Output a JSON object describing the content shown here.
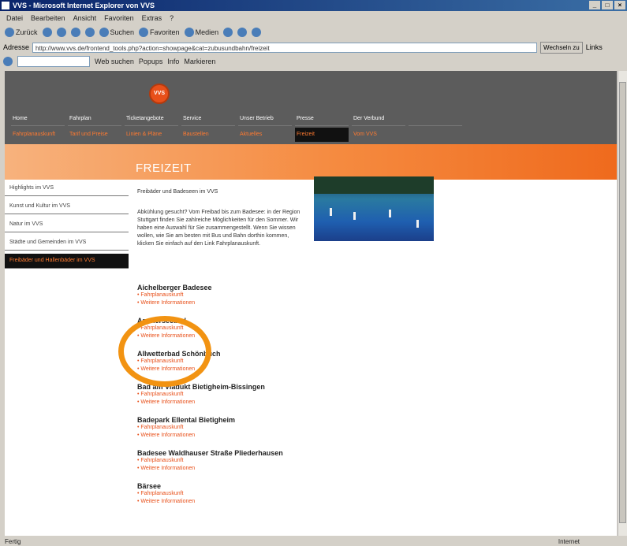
{
  "window": {
    "title": "VVS - Microsoft Internet Explorer von VVS"
  },
  "menubar": [
    "Datei",
    "Bearbeiten",
    "Ansicht",
    "Favoriten",
    "Extras",
    "?"
  ],
  "toolbar": {
    "back": "Zurück",
    "search": "Suchen",
    "favorites": "Favoriten",
    "media": "Medien"
  },
  "address": {
    "label": "Adresse",
    "url": "http://www.vvs.de/frontend_tools.php?action=showpage&cat=zubusundbahn/freizeit",
    "go": "Wechseln zu",
    "links": "Links"
  },
  "linksbar": {
    "search_web": "Web suchen",
    "popups": "Popups",
    "info": "Info",
    "highlight": "Markieren"
  },
  "site": {
    "logo_text": "VVS",
    "nav_top": [
      "Home",
      "Fahrplan",
      "Ticketangebote",
      "Service",
      "Unser Betrieb",
      "Presse",
      "Der Verbund",
      ""
    ],
    "nav_bottom": [
      "Fahrplanauskunft",
      "Tarif und Preise",
      "Linien & Pläne",
      "Baustellen",
      "Aktuelles",
      "Freizeit",
      "Vom VVS",
      ""
    ],
    "page_title": "FREIZEIT",
    "left_nav": [
      "Highlights im VVS",
      "Kunst und Kultur im VVS",
      "Natur im VVS",
      "Städte und Gemeinden im VVS",
      "Freibäder und Hallenbäder im VVS"
    ],
    "intro_heading": "Freibäder und Badeseen im VVS",
    "intro_text": "Abkühlung gesucht? Vom Freibad bis zum Badesee: in der Region Stuttgart finden Sie zahlreiche Möglichkeiten für den Sommer. Wir haben eine Auswahl für Sie zusammengestellt. Wenn Sie wissen wollen, wie Sie am besten mit Bus und Bahn dorthin kommen, klicken Sie einfach auf den Link Fahrplanauskunft.",
    "pools": [
      {
        "name": "Aichelberger Badesee",
        "links": [
          "Fahrplanauskunft",
          "Weitere Informationen"
        ]
      },
      {
        "name": "Ammerseebad",
        "links": [
          "Fahrplanauskunft",
          "Weitere Informationen"
        ]
      },
      {
        "name": "Allwetterbad Schönbuch",
        "links": [
          "Fahrplanauskunft",
          "Weitere Informationen"
        ]
      },
      {
        "name": "Bad am Viadukt Bietigheim-Bissingen",
        "links": [
          "Fahrplanauskunft",
          "Weitere Informationen"
        ]
      },
      {
        "name": "Badepark Ellental Bietigheim",
        "links": [
          "Fahrplanauskunft",
          "Weitere Informationen"
        ]
      },
      {
        "name": "Badesee Waldhauser Straße Pliederhausen",
        "links": [
          "Fahrplanauskunft",
          "Weitere Informationen"
        ]
      },
      {
        "name": "Bärsee",
        "links": [
          "Fahrplanauskunft",
          "Weitere Informationen"
        ]
      }
    ]
  },
  "status": {
    "left": "Fertig",
    "zone": "Internet"
  },
  "colors": {
    "accent": "#e8501a",
    "highlight_circle": "#f29312",
    "header": "#5c5c5c"
  }
}
